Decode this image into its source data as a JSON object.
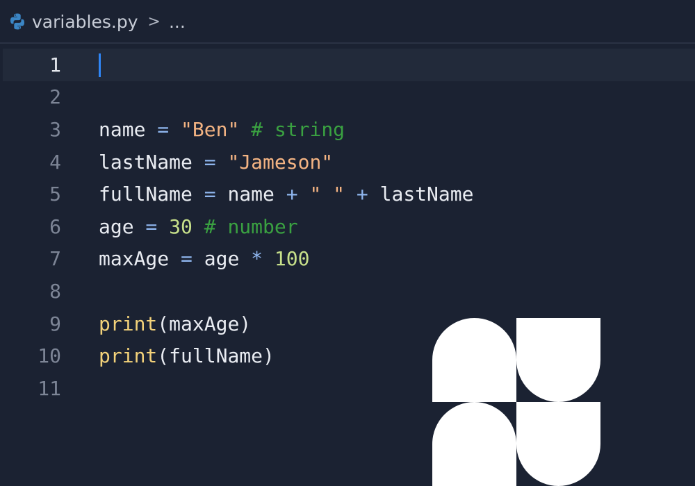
{
  "breadcrumb": {
    "file_name": "variables.py",
    "separator": ">",
    "more": "..."
  },
  "editor": {
    "current_line": 1,
    "lines": [
      {
        "number": "1",
        "tokens": []
      },
      {
        "number": "2",
        "tokens": []
      },
      {
        "number": "3",
        "tokens": [
          {
            "t": "var",
            "v": "name"
          },
          {
            "t": "op",
            "v": " = "
          },
          {
            "t": "str",
            "v": "\"Ben\""
          },
          {
            "t": "com",
            "v": " # string"
          }
        ]
      },
      {
        "number": "4",
        "tokens": [
          {
            "t": "var",
            "v": "lastName"
          },
          {
            "t": "op",
            "v": " = "
          },
          {
            "t": "str",
            "v": "\"Jameson\""
          }
        ]
      },
      {
        "number": "5",
        "tokens": [
          {
            "t": "var",
            "v": "fullName"
          },
          {
            "t": "op",
            "v": " = "
          },
          {
            "t": "var",
            "v": "name"
          },
          {
            "t": "op",
            "v": " + "
          },
          {
            "t": "str",
            "v": "\" \""
          },
          {
            "t": "op",
            "v": " + "
          },
          {
            "t": "var",
            "v": "lastName"
          }
        ]
      },
      {
        "number": "6",
        "tokens": [
          {
            "t": "var",
            "v": "age"
          },
          {
            "t": "op",
            "v": " = "
          },
          {
            "t": "num",
            "v": "30"
          },
          {
            "t": "com",
            "v": " # number"
          }
        ]
      },
      {
        "number": "7",
        "tokens": [
          {
            "t": "var",
            "v": "maxAge"
          },
          {
            "t": "op",
            "v": " = "
          },
          {
            "t": "var",
            "v": "age"
          },
          {
            "t": "op",
            "v": " * "
          },
          {
            "t": "num",
            "v": "100"
          }
        ]
      },
      {
        "number": "8",
        "tokens": []
      },
      {
        "number": "9",
        "tokens": [
          {
            "t": "fn",
            "v": "print"
          },
          {
            "t": "var",
            "v": "(maxAge)"
          }
        ]
      },
      {
        "number": "10",
        "tokens": [
          {
            "t": "fn",
            "v": "print"
          },
          {
            "t": "var",
            "v": "(fullName)"
          }
        ]
      },
      {
        "number": "11",
        "tokens": []
      }
    ]
  },
  "colors": {
    "background": "#1b2232",
    "current_line_bg": "#222a3a",
    "cursor": "#2f86f6",
    "string": "#f4b483",
    "number": "#c7e08a",
    "comment": "#3aa141",
    "operator": "#8fb6ee",
    "function": "#f3d27a"
  },
  "icons": {
    "file_icon": "python-icon",
    "logo": "brand-logo-shapes"
  }
}
